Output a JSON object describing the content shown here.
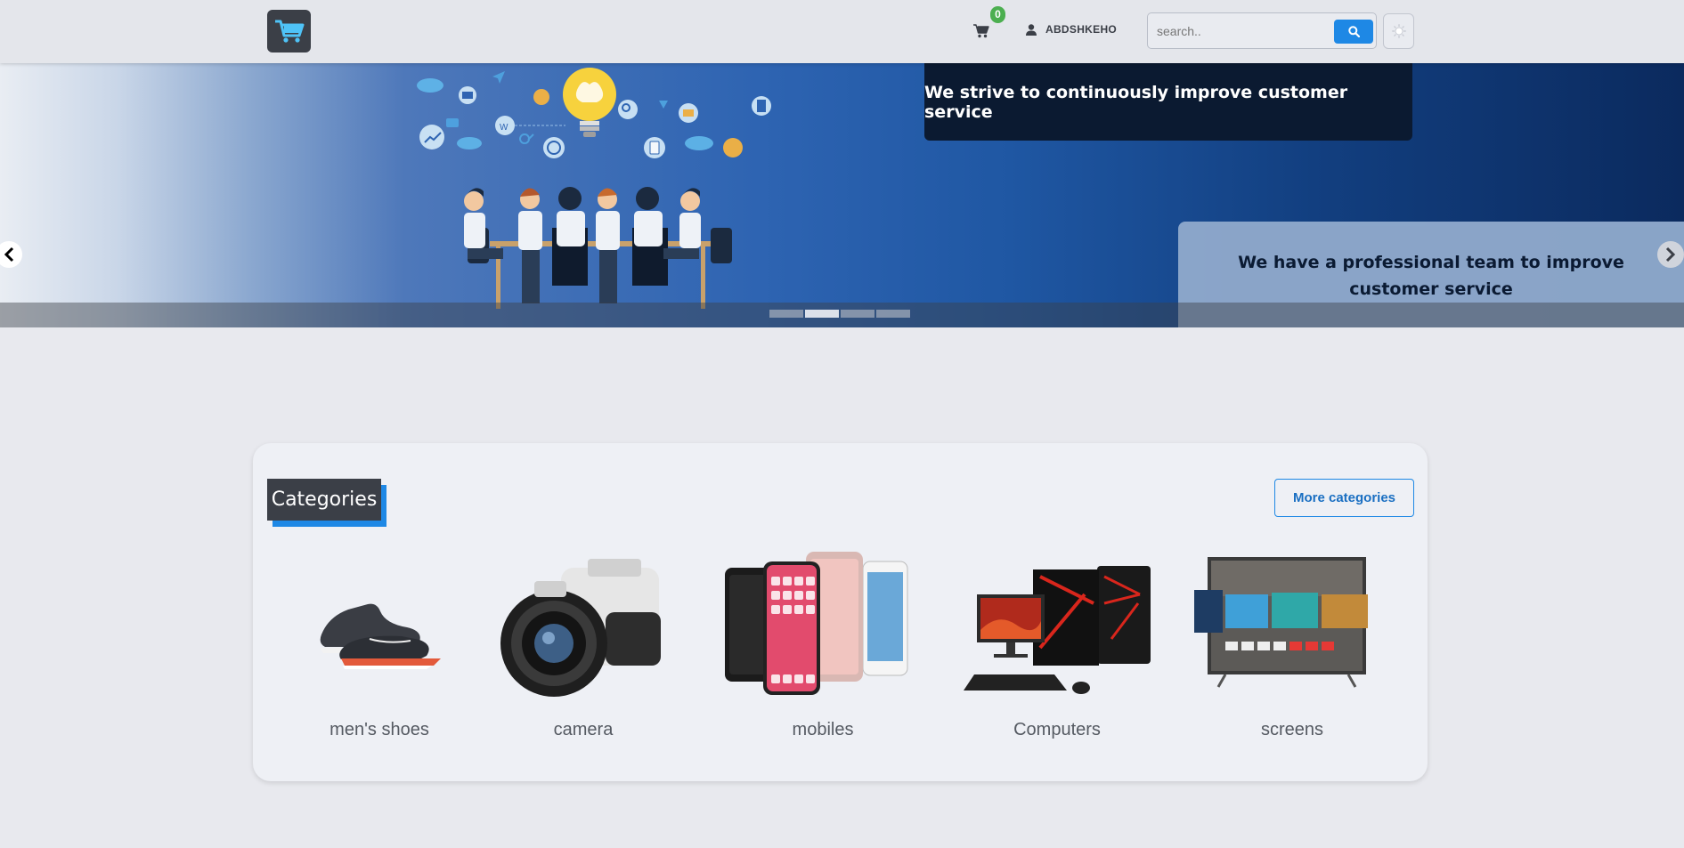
{
  "header": {
    "cart_count": "0",
    "user_name": "ABDSHKEHO",
    "search_placeholder": "search..",
    "icons": {
      "logo": "shopping-cart-logo",
      "cart": "cart-icon",
      "user": "user-icon",
      "search": "search-icon",
      "theme": "sun-icon"
    }
  },
  "hero": {
    "caption_top": "We strive to continuously improve customer service",
    "caption_bottom": "We have a professional team to improve customer service",
    "slides_count": 4,
    "active_slide": 2
  },
  "categories": {
    "title": "Categories",
    "more_label": "More categories",
    "items": [
      {
        "label": "men's shoes"
      },
      {
        "label": "camera"
      },
      {
        "label": "mobiles"
      },
      {
        "label": "Computers"
      },
      {
        "label": "screens"
      }
    ]
  },
  "colors": {
    "accent": "#1e88e5",
    "badge": "#4caf50",
    "dark": "#3b3f47"
  }
}
